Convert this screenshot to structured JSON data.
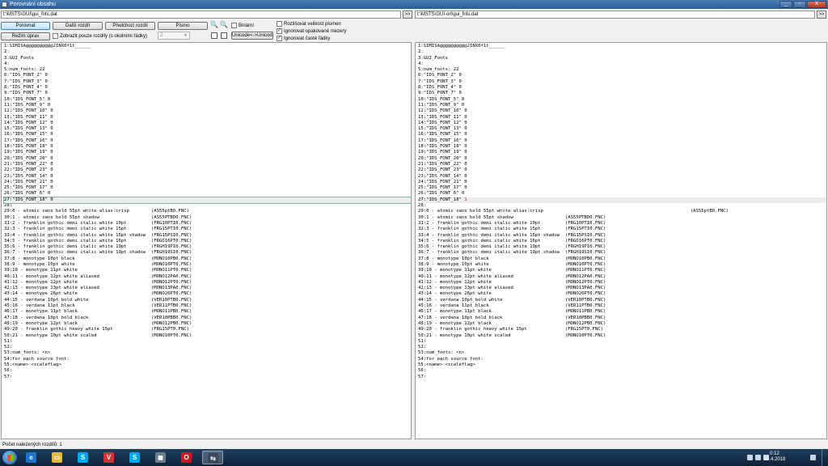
{
  "window": {
    "title": "Porovnání obsahu",
    "controls": [
      "_",
      "▫",
      "X"
    ]
  },
  "paths": {
    "left": "t:\\MSTS\\GUI\\gui_fnts.dat",
    "right": "t:\\MSTS\\GUI-orl\\gui_fnts.dat",
    "browse_label": ">>"
  },
  "toolbar": {
    "compare": "Porovnat",
    "next_diff": "Další rozdíl",
    "prev_diff": "Předchozí rozdíl",
    "font": "Písmo",
    "edit_mode": "Režim úprav",
    "show_diffs_only": "Zobrazit pouze rozdíly (s okolními řádky)",
    "context_lines": "2",
    "binary": "Binární",
    "unicode_toggle": "Unicode<->Unicode",
    "case_sensitive": "Rozlišovat velikost písmen",
    "ignore_spaces": "Ignorovat opakované mezery",
    "ignore_frequent": "Ignorovat časté řádky",
    "checks": {
      "show_diffs_only": false,
      "binary": false,
      "case_sensitive": false,
      "ignore_spaces": true,
      "ignore_frequent": true
    }
  },
  "left_lines": [
    "1:SIMISA@@@@@@@@@@JINX0f1t______",
    "2:",
    "3:GUI_Fonts",
    "4:",
    "5:num_fonts: 22",
    "6:\"IDS_FONT_2\" 0",
    "7:\"IDS_FONT_3\" 0",
    "8:\"IDS_FONT_4\" 0",
    "9:\"IDS_FONT_7\" 0",
    "10:\"IDS_FONT_5\" 0",
    "11:\"IDS_FONT_9\" 0",
    "12:\"IDS_FONT_10\" 0",
    "13:\"IDS_FONT_11\" 0",
    "14:\"IDS_FONT_12\" 0",
    "15:\"IDS_FONT_13\" 0",
    "16:\"IDS_FONT_15\" 0",
    "17:\"IDS_FONT_16\" 0",
    "18:\"IDS_FONT_18\" 0",
    "19:\"IDS_FONT_19\" 0",
    "20:\"IDS_FONT_20\" 0",
    "21:\"IDS_FONT_22\" 0",
    "22:\"IDS_FONT_23\" 0",
    "23:\"IDS_FONT_14\" 0",
    "24:\"IDS_FONT_21\" 0",
    "25:\"IDS_FONT_17\" 0",
    "26:\"IDS_FONT_6\" 0",
    "27:\"IDS_FONT_18\" 0",
    "28:",
    "29:0 - atomic sans bold 55pt white alias:crisp        (AS55ptB0.FNC)",
    "30:1 - atomic sans bold 55pt shadow                   (AS55PTBD0.FNC)",
    "31:2 - franklin gothic demi italic white 10pt         (FRG10PTI0.FNC)",
    "32:3 - franklin gothic demi italic white 15pt         (FRG15PTI0.FNC)",
    "33:4 - franklin gothic demi italic white 15pt shadow  (FRG15PSI0.FNC)",
    "34:5 - franklin gothic demi italic white 16pt         (FRGD16PT0.FNC)",
    "35:6 - franklin gothic demi italic white 19pt         (FRGH19PI0.FNC)",
    "36:7 - franklin gothic demi italic white 19pt shadow  (FRGH19SI0.FNC)",
    "37:8 - monotype 10pt black                            (MONO10PB0.FNC)",
    "38:9 - monotype 10pt white                            (MONO10PT0.FNC)",
    "39:10 - monotype 11pt white                           (MONO11PT0.FNC)",
    "40:11 - monotype 12pt white aliased                   (MONO12PA0.FNC)",
    "41:12 - monotype 12pt white                           (MONO12PT0.FNC)",
    "42:13 - monotype 13pt white aliased                   (MONO13PA0.FNC)",
    "43:14 - monotype 26pt white                           (MONO26PT0.FNC)",
    "44:15 - verdana 10pt bold white                       (VER10PTB0.FNC)",
    "45:16 - verdana 11pt black                            (VER11PTB0.FNC)",
    "46:17 - monotype 11pt black                           (MONO11PB0.FNC)",
    "47:18 - verdana 10pt bold black                       (VER10PBB0.FNC)",
    "48:19 - monotype 12pt black                           (MONO12PB0.FNC)",
    "49:20 - franklin gothic heavy white 15pt              (FRG15PT0.FNC)",
    "50:21 - monotype 10pt white scaled                    (MONO10PT0.FNC)",
    "51:",
    "52:",
    "53:num_fonts: <n>",
    "54:for each source font:",
    "55:<name> <scaleflag>",
    "56:",
    "57:"
  ],
  "right_lines": [
    "1:SIMISA@@@@@@@@@@JINX0f1t______",
    "2:",
    "3:GUI_Fonts",
    "4:",
    "5:num_fonts: 22",
    "6:\"IDS_FONT_2\" 0",
    "7:\"IDS_FONT_3\" 0",
    "8:\"IDS_FONT_4\" 0",
    "9:\"IDS_FONT_7\" 0",
    "10:\"IDS_FONT_5\" 0",
    "11:\"IDS_FONT_9\" 0",
    "12:\"IDS_FONT_10\" 0",
    "13:\"IDS_FONT_11\" 0",
    "14:\"IDS_FONT_12\" 0",
    "15:\"IDS_FONT_13\" 0",
    "16:\"IDS_FONT_15\" 0",
    "17:\"IDS_FONT_16\" 0",
    "18:\"IDS_FONT_18\" 0",
    "19:\"IDS_FONT_19\" 0",
    "20:\"IDS_FONT_20\" 0",
    "21:\"IDS_FONT_22\" 0",
    "22:\"IDS_FONT_23\" 0",
    "23:\"IDS_FONT_14\" 0",
    "24:\"IDS_FONT_21\" 0",
    "25:\"IDS_FONT_17\" 0",
    "26:\"IDS_FONT_6\" 0",
    "27:\"IDS_FONT_18\" 1",
    "28:",
    "29:0 - atomic sans bold 55pt white alias:crisp                                                      (AS55ptB0.FNC)",
    "30:1 - atomic sans bold 55pt shadow                   (AS55PTBD0.FNC)",
    "31:2 - franklin gothic demi italic white 10pt         (FRG10PTI0.FNC)",
    "32:3 - franklin gothic demi italic white 15pt         (FRG15PTI0.FNC)",
    "33:4 - franklin gothic demi italic white 15pt shadow  (FRG15PSI0.FNC)",
    "34:5 - franklin gothic demi italic white 16pt         (FRGD16PT0.FNC)",
    "35:6 - franklin gothic demi italic white 19pt         (FRGH19PI0.FNC)",
    "36:7 - franklin gothic demi italic white 19pt shadow  (FRGH19SI0.FNC)",
    "37:8 - monotype 10pt black                            (MONO10PB0.FNC)",
    "38:9 - monotype 10pt white                            (MONO10PT0.FNC)",
    "39:10 - monotype 11pt white                           (MONO11PT0.FNC)",
    "40:11 - monotype 12pt white aliased                   (MONO12PA0.FNC)",
    "41:12 - monotype 12pt white                           (MONO12PT0.FNC)",
    "42:13 - monotype 13pt white aliased                   (MONO13PA0.FNC)",
    "43:14 - monotype 26pt white                           (MONO26PT0.FNC)",
    "44:15 - verdana 10pt bold white                       (VER10PTB0.FNC)",
    "45:16 - verdana 11pt black                            (VER11PTB0.FNC)",
    "46:17 - monotype 11pt black                           (MONO11PB0.FNC)",
    "47:18 - verdana 10pt bold black                       (VER10PBB0.FNC)",
    "48:19 - monotype 12pt black                           (MONO12PB0.FNC)",
    "49:20 - franklin gothic heavy white 15pt              (FRG15PT0.FNC)",
    "50:21 - monotype 10pt white scaled                    (MONO10PT0.FNC)",
    "51:",
    "52:",
    "53:num_fonts: <n>",
    "54:for each source font:",
    "55:<name> <scaleflag>",
    "56:",
    "57:"
  ],
  "highlighted_line": 27,
  "status": {
    "text": "Počet nalezených rozdílů: 1"
  },
  "taskbar": {
    "apps": [
      {
        "icon": "internet-explorer-icon",
        "glyph": "e",
        "color": "#1f73c8"
      },
      {
        "icon": "file-explorer-icon",
        "glyph": "▭",
        "color": "#e2b84a"
      },
      {
        "icon": "skype-icon",
        "glyph": "S",
        "color": "#00a6e6"
      },
      {
        "icon": "vivaldi-icon",
        "glyph": "V",
        "color": "#d23434"
      },
      {
        "icon": "skype-icon-2",
        "glyph": "S",
        "color": "#00a6e6"
      },
      {
        "icon": "disk-utility-icon",
        "glyph": "◼",
        "color": "#6c7c8c"
      },
      {
        "icon": "opera-icon",
        "glyph": "O",
        "color": "#cc1a24"
      },
      {
        "icon": "compare-tool-icon",
        "glyph": "⇆",
        "color": "#3a4a5a"
      }
    ],
    "clock_time": "0:12",
    "clock_date": "20.4.2018"
  }
}
